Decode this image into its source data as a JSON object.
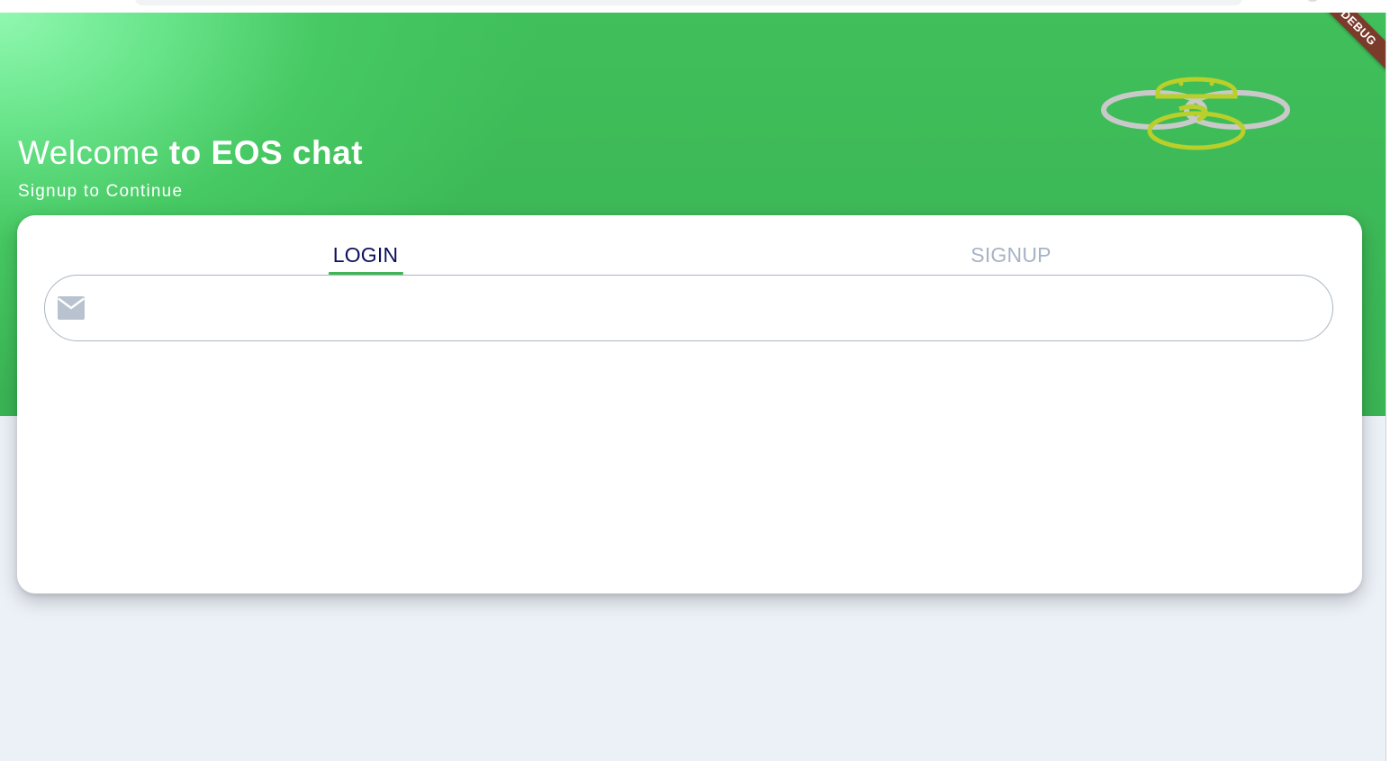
{
  "header": {
    "welcome_light": "Welcome ",
    "welcome_bold": "to EOS chat",
    "subtitle": "Signup to Continue",
    "logo_icon": "eos-chat-logo",
    "debug_label": "DEBUG",
    "gradient_colors": [
      "#90f8b0",
      "#3fbb57"
    ]
  },
  "tabs": {
    "login_label": "LOGIN",
    "signup_label": "SIGNUP",
    "active": "LOGIN",
    "active_color": "#0a0f5c",
    "inactive_color": "#a7b3c4",
    "indicator_color": "#3fb554"
  },
  "form": {
    "email_icon": "mail-icon",
    "email_value": "",
    "email_placeholder": ""
  },
  "colors": {
    "background": "#ecf1f8",
    "card": "#ffffff",
    "field_border": "#a9b5c3"
  }
}
